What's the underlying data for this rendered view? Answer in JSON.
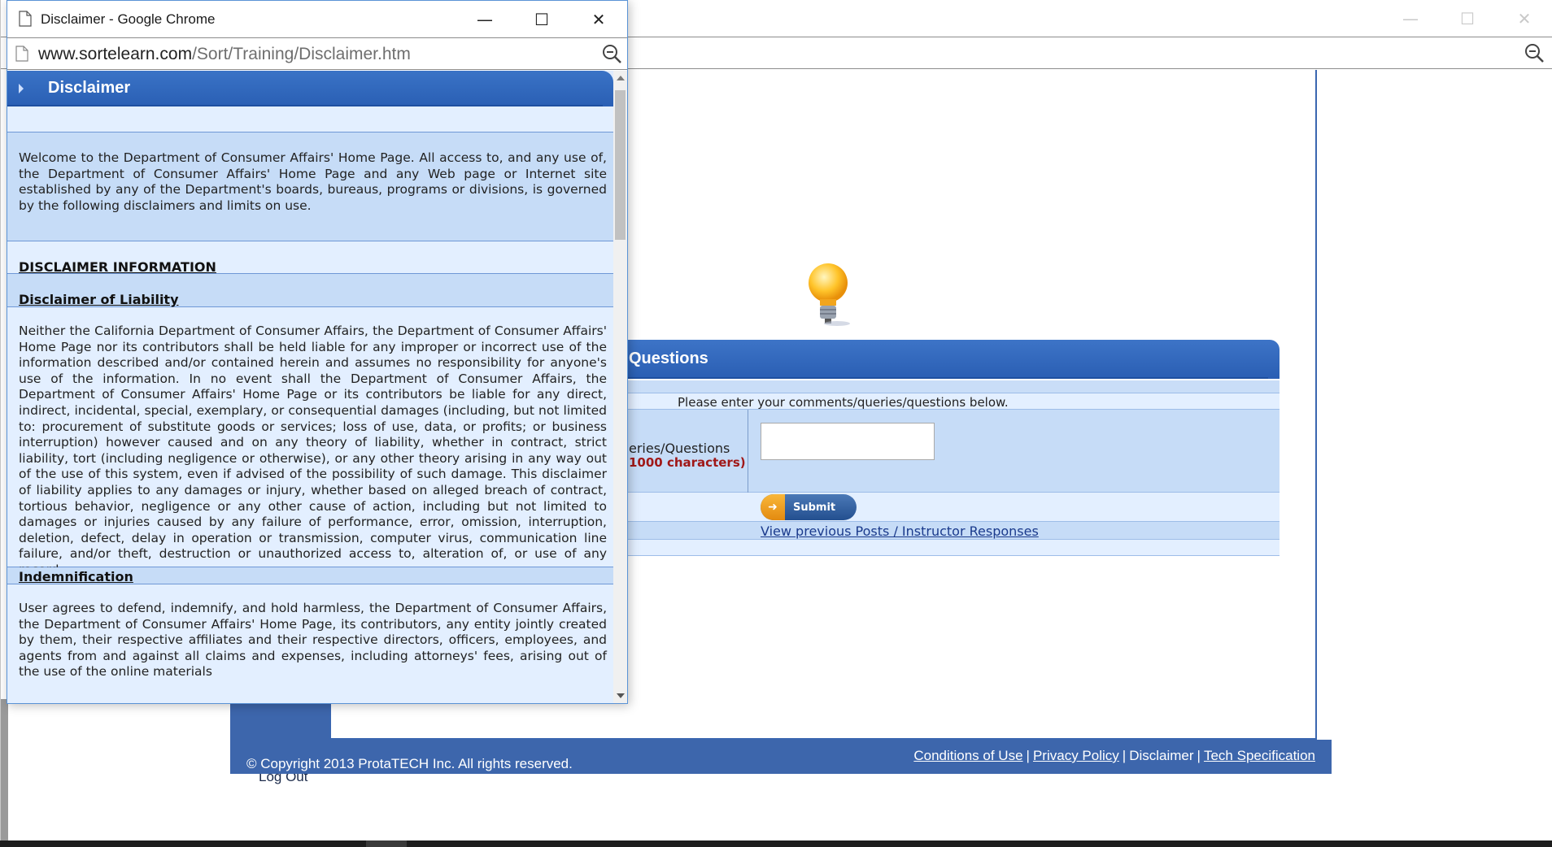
{
  "background_window": {
    "controls": {
      "minimize": "—",
      "maximize": "☐",
      "close": "✕"
    }
  },
  "site": {
    "questions_panel": {
      "title": "Questions",
      "prompt": "Please enter your comments/queries/questions below.",
      "field_label": "eries/Questions",
      "limit_note": "1000 characters)",
      "submit_label": "Submit",
      "previous_posts_link": "View previous Posts / Instructor Responses"
    },
    "nav": {
      "logout": "Log Out"
    },
    "footer": {
      "copyright": "© Copyright 2013 ProtaTECH Inc. All rights reserved.",
      "links": {
        "conditions": "Conditions of Use",
        "privacy": "Privacy Policy",
        "disclaimer": "Disclaimer",
        "tech": "Tech Specification",
        "separator": "|"
      }
    }
  },
  "popup": {
    "window_title": "Disclaimer - Google Chrome",
    "controls": {
      "minimize": "—",
      "maximize": "☐",
      "close": "✕"
    },
    "url": {
      "domain": "www.sortelearn.com",
      "path": "/Sort/Training/Disclaimer.htm"
    },
    "page": {
      "header_title": "Disclaimer",
      "intro": "Welcome to the Department of Consumer Affairs' Home Page.  All access to, and any use of, the Department of Consumer Affairs' Home Page and any Web page or Internet site established by any of the Department's boards, bureaus, programs or divisions, is governed by the following disclaimers and limits on use.",
      "section_info_heading": "DISCLAIMER INFORMATION",
      "liability_heading": "Disclaimer of Liability",
      "liability_text": "Neither the California Department of Consumer Affairs, the Department of Consumer Affairs' Home Page nor its contributors shall be held liable for any improper or incorrect use of the information described and/or contained herein and assumes no responsibility for anyone's use of the information. In no event shall the Department of Consumer Affairs, the Department of Consumer Affairs' Home Page or its contributors be liable for any direct, indirect, incidental, special, exemplary, or consequential damages (including, but not limited to: procurement of substitute goods or services; loss of use, data, or profits; or business interruption) however caused and on any theory of liability, whether in contract, strict liability, tort (including negligence or otherwise), or any other theory arising in any way out of the use of this system, even if advised of the possibility of such damage. This disclaimer of liability applies to any damages or injury, whether based on alleged breach of contract, tortious behavior, negligence or any other cause of action, including but not limited to damages or injuries caused by any failure of performance, error, omission, interruption, deletion, defect, delay in operation or transmission, computer virus, communication line failure, and/or theft, destruction or unauthorized access to, alteration of, or use of any record.",
      "indemnification_heading": "Indemnification",
      "indemnification_text": "User agrees to defend, indemnify, and hold harmless, the Department of Consumer Affairs, the Department of Consumer Affairs' Home Page, its contributors, any entity jointly created by them, their respective affiliates and their respective directors, officers, employees, and agents from and against all claims and expenses, including attorneys' fees, arising out of the use of the online materials"
    }
  },
  "colors": {
    "header_blue": "#2a5fb4",
    "band_light": "#e3efff",
    "band_mid": "#c6dcf7",
    "footer_blue": "#3d66ac",
    "limit_red": "#a01818"
  }
}
